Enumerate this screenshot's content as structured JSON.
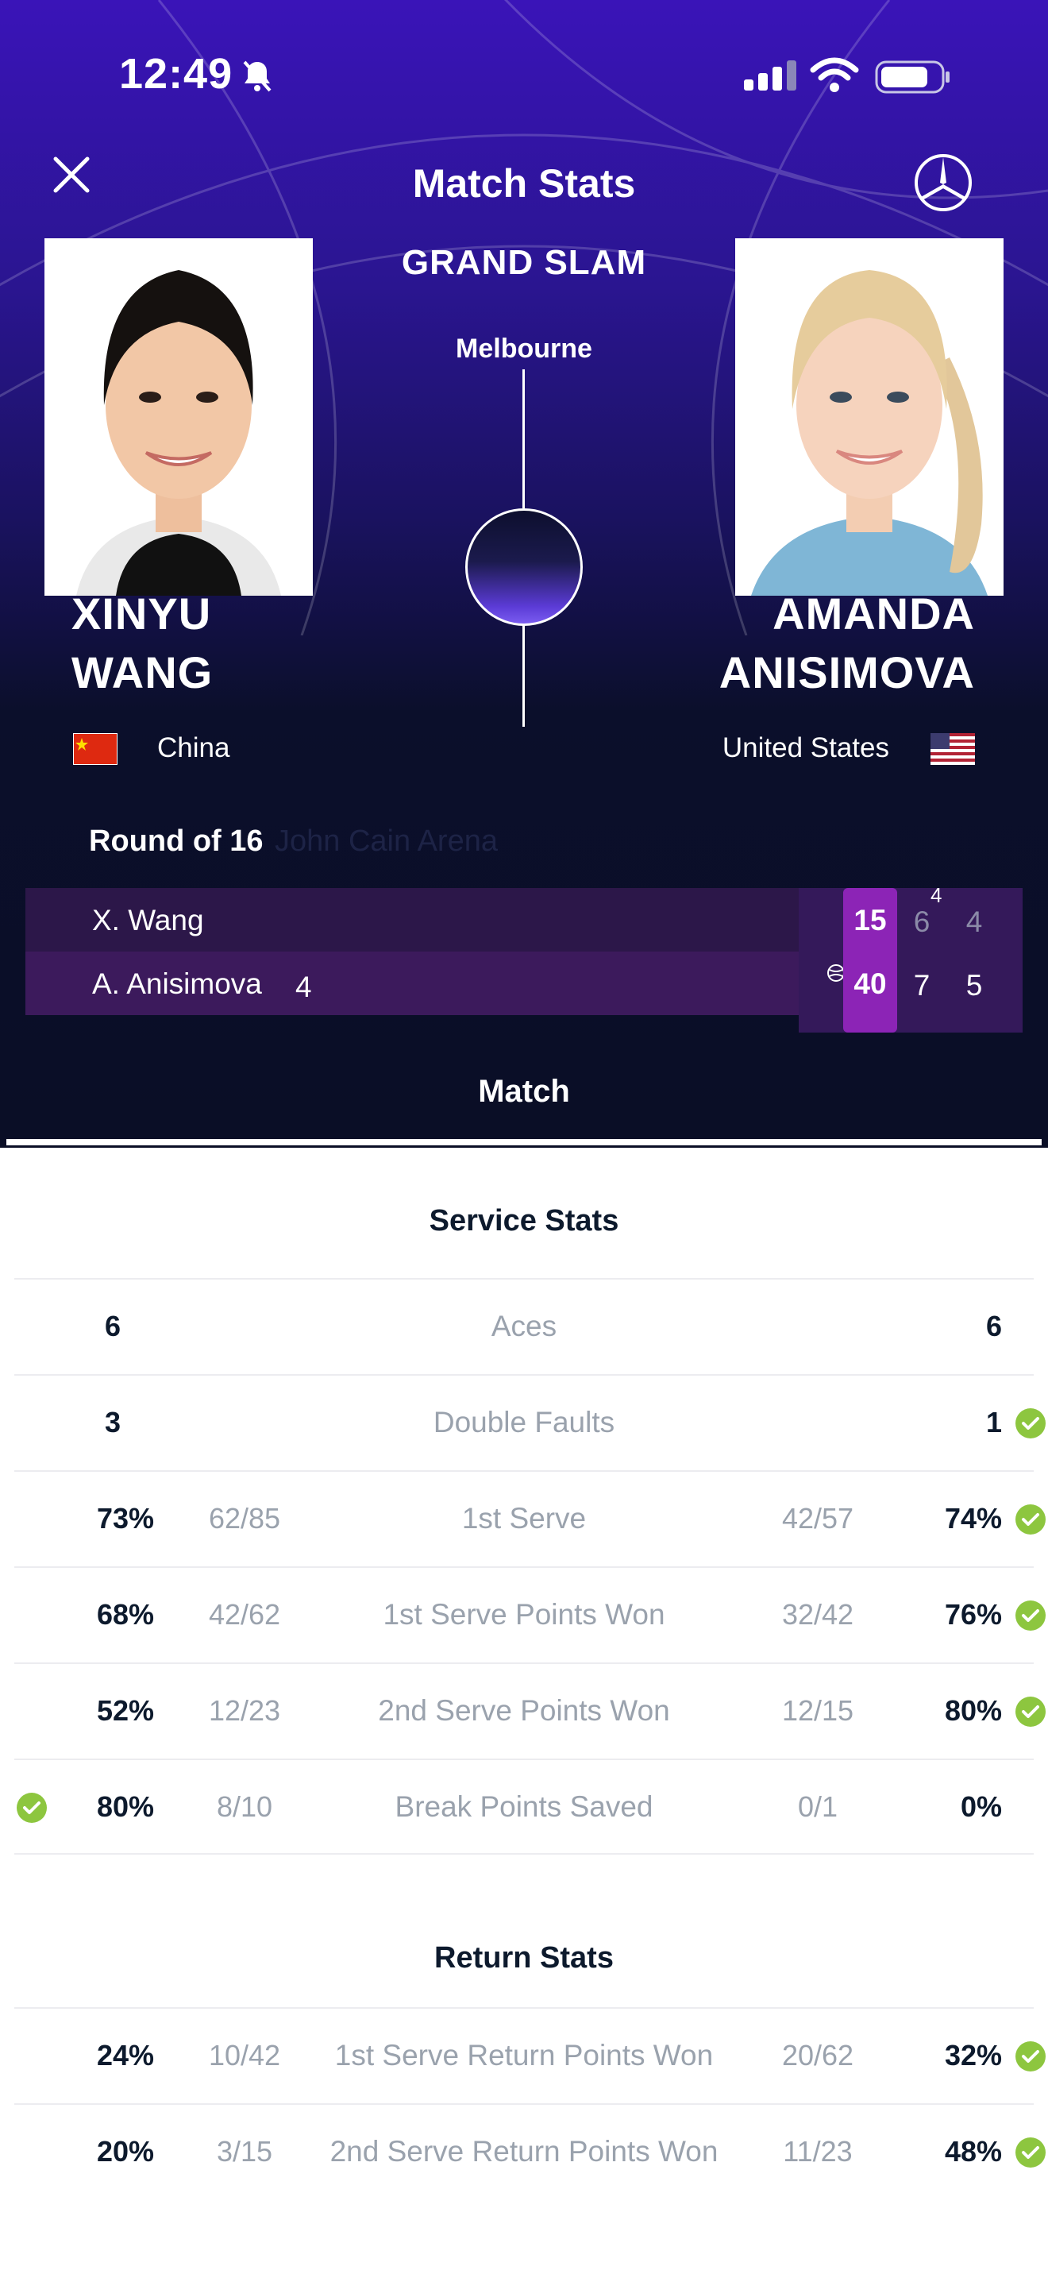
{
  "status_bar": {
    "time": "12:49"
  },
  "header": {
    "title": "Match Stats",
    "event": "GRAND SLAM",
    "city": "Melbourne"
  },
  "players": {
    "left": {
      "first": "XINYU",
      "last": "WANG",
      "country": "China"
    },
    "right": {
      "first": "AMANDA",
      "last": "ANISIMOVA",
      "country": "United States"
    }
  },
  "match": {
    "round": "Round of 16",
    "venue": "John Cain Arena",
    "scoreboard": {
      "p1": {
        "name": "X. Wang",
        "seed": "",
        "game": "15",
        "set1": "6",
        "set1_tiebreak": "4",
        "set2": "4"
      },
      "p2": {
        "name": "A. Anisimova",
        "seed": "4",
        "game": "40",
        "set1": "7",
        "set2": "5"
      }
    }
  },
  "tabs": {
    "active": "Match"
  },
  "service_stats": {
    "title": "Service Stats",
    "rows": [
      {
        "label": "Aces",
        "left": "6",
        "left_frac": "",
        "right": "6",
        "right_frac": ""
      },
      {
        "label": "Double Faults",
        "left": "3",
        "left_frac": "",
        "right": "1",
        "right_frac": ""
      },
      {
        "label": "1st Serve",
        "left": "73%",
        "left_frac": "62/85",
        "right": "74%",
        "right_frac": "42/57"
      },
      {
        "label": "1st Serve Points Won",
        "left": "68%",
        "left_frac": "42/62",
        "right": "76%",
        "right_frac": "32/42"
      },
      {
        "label": "2nd Serve Points Won",
        "left": "52%",
        "left_frac": "12/23",
        "right": "80%",
        "right_frac": "12/15"
      },
      {
        "label": "Break Points Saved",
        "left": "80%",
        "left_frac": "8/10",
        "right": "0%",
        "right_frac": "0/1"
      }
    ]
  },
  "return_stats": {
    "title": "Return Stats",
    "rows": [
      {
        "label": "1st Serve Return Points Won",
        "left": "24%",
        "left_frac": "10/42",
        "right": "32%",
        "right_frac": "20/62"
      },
      {
        "label": "2nd Serve Return Points Won",
        "left": "20%",
        "left_frac": "3/15",
        "right": "48%",
        "right_frac": "11/23"
      }
    ]
  },
  "colors": {
    "accent_purple": "#8c24b6",
    "check_green": "#8dc63f",
    "dark_bg": "#0a0e26"
  }
}
